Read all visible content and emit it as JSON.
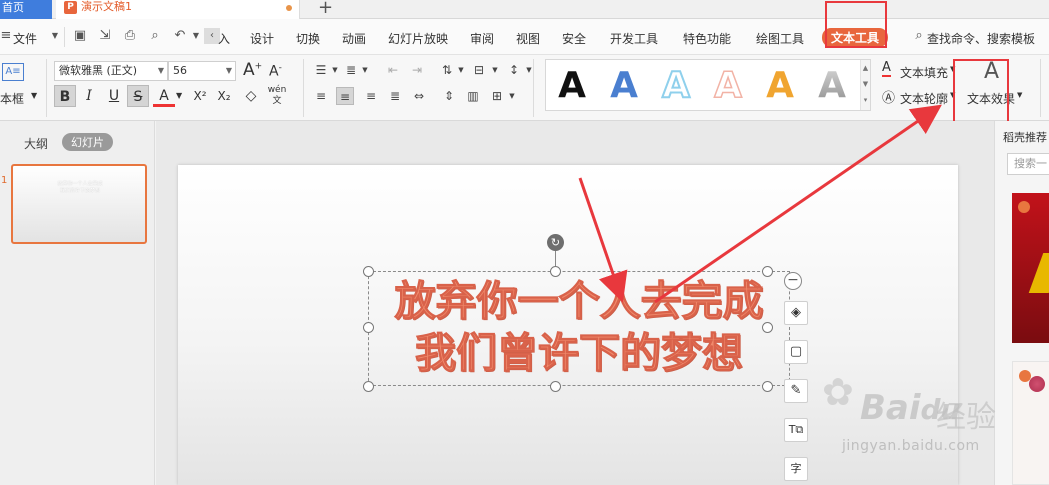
{
  "titlebar": {
    "home_tab": "首页",
    "doc_tab": "演示文稿1",
    "new_tab": "+"
  },
  "menubar": {
    "file": "文件",
    "trunc": "入",
    "items": [
      "设计",
      "切换",
      "动画",
      "幻灯片放映",
      "审阅",
      "视图",
      "安全",
      "开发工具",
      "特色功能",
      "绘图工具",
      "文本工具"
    ],
    "search": "查找命令、搜索模板"
  },
  "ribbon": {
    "textbox_label": "本框",
    "font_name": "微软雅黑 (正文)",
    "font_size": "56",
    "grow_font": "A",
    "shrink_font": "A",
    "bold": "B",
    "italic": "I",
    "underline": "U",
    "strike": "S",
    "font_color": "A",
    "superscript": "X²",
    "subscript": "X₂",
    "phonetic": "wén",
    "text_fill": "文本填充",
    "text_outline": "文本轮廓",
    "text_effect": "文本效果"
  },
  "text_styles": [
    {
      "glyph": "A",
      "color": "#111111"
    },
    {
      "glyph": "A",
      "color": "#4a7fd0"
    },
    {
      "glyph": "A",
      "color": "#8fd0ec"
    },
    {
      "glyph": "A",
      "color": "#f2b3a6"
    },
    {
      "glyph": "A",
      "color": "#f0a530"
    },
    {
      "glyph": "A",
      "color": "#8a8a8a"
    }
  ],
  "left_panel": {
    "outline_tab": "大纲",
    "slides_tab": "幻灯片",
    "slide_number": "1"
  },
  "slide": {
    "line1": "放弃你一个人去完成",
    "line2": "我们曾许下的梦想"
  },
  "right_panel": {
    "title": "稻壳推荐",
    "search_placeholder": "搜索一"
  },
  "watermark": {
    "brand": "Bai",
    "brand_cn": "经验",
    "url": "jingyan.baidu.com"
  },
  "colors": {
    "accent": "#e8663d",
    "highlight": "#e8383d",
    "slide_text": "#f08a6c",
    "home_tab": "#3f7ddd"
  }
}
